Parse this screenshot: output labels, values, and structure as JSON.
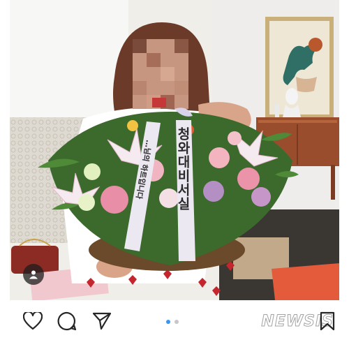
{
  "post": {
    "ribbon_left_text": "…님의 하트입니다",
    "ribbon_right_text": "청와대비서실",
    "carousel": {
      "count": 2,
      "active_index": 0
    }
  },
  "icons": [
    "heart-icon",
    "comment-icon",
    "share-icon",
    "bookmark-icon",
    "user-tag-icon"
  ],
  "watermark": {
    "text": "NEWSIS"
  },
  "colors": {
    "ribbon": "#ece8f2",
    "ribbon_ink": "#2a2a2a",
    "dot_active": "#3897f0",
    "dot_inactive": "#c7c7c7",
    "icon_stroke": "#262626"
  }
}
